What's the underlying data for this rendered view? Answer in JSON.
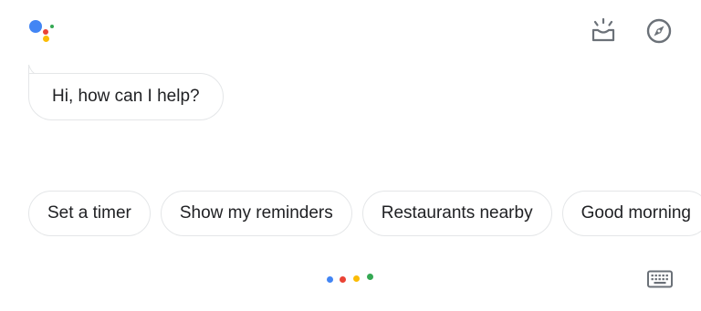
{
  "assistant": {
    "greeting": "Hi, how can I help?"
  },
  "suggestions": [
    {
      "label": "Set a timer"
    },
    {
      "label": "Show my reminders"
    },
    {
      "label": "Restaurants nearby"
    },
    {
      "label": "Good morning"
    }
  ],
  "icons": {
    "logo": "google-assistant-logo",
    "snapshot": "snapshot-icon",
    "explore": "compass-icon",
    "keyboard": "keyboard-icon"
  },
  "colors": {
    "blue": "#4285F4",
    "red": "#EA4335",
    "yellow": "#FBBC05",
    "green": "#34A853",
    "icon_gray": "#6b7178",
    "chip_border": "#e4e6e8"
  }
}
